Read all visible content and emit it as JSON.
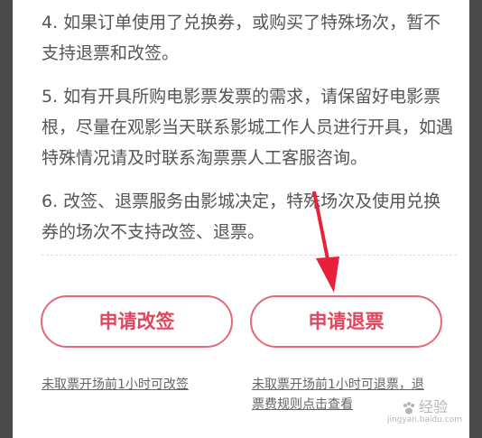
{
  "notes": [
    "4. 如果订单使用了兑换券，或购买了特殊场次，暂不支持退票和改签。",
    "5. 如有开具所购电影票发票的需求，请保留好电影票根，尽量在观影当天联系影城工作人员进行开具，如遇特殊情况请及时联系淘票票人工客服咨询。",
    "6. 改签、退票服务由影城决定，特殊场次及使用兑换券的场次不支持改签、退票。"
  ],
  "actions": {
    "change_label": "申请改签",
    "refund_label": "申请退票",
    "change_hint": "未取票开场前1小时可改签",
    "refund_hint": "未取票开场前1小时可退票，退票费规则点击查看"
  },
  "watermark": {
    "text": "经验",
    "sub": "jingyan.baidu.com"
  },
  "colors": {
    "accent": "#e0475e",
    "arrow": "#e8203a"
  }
}
